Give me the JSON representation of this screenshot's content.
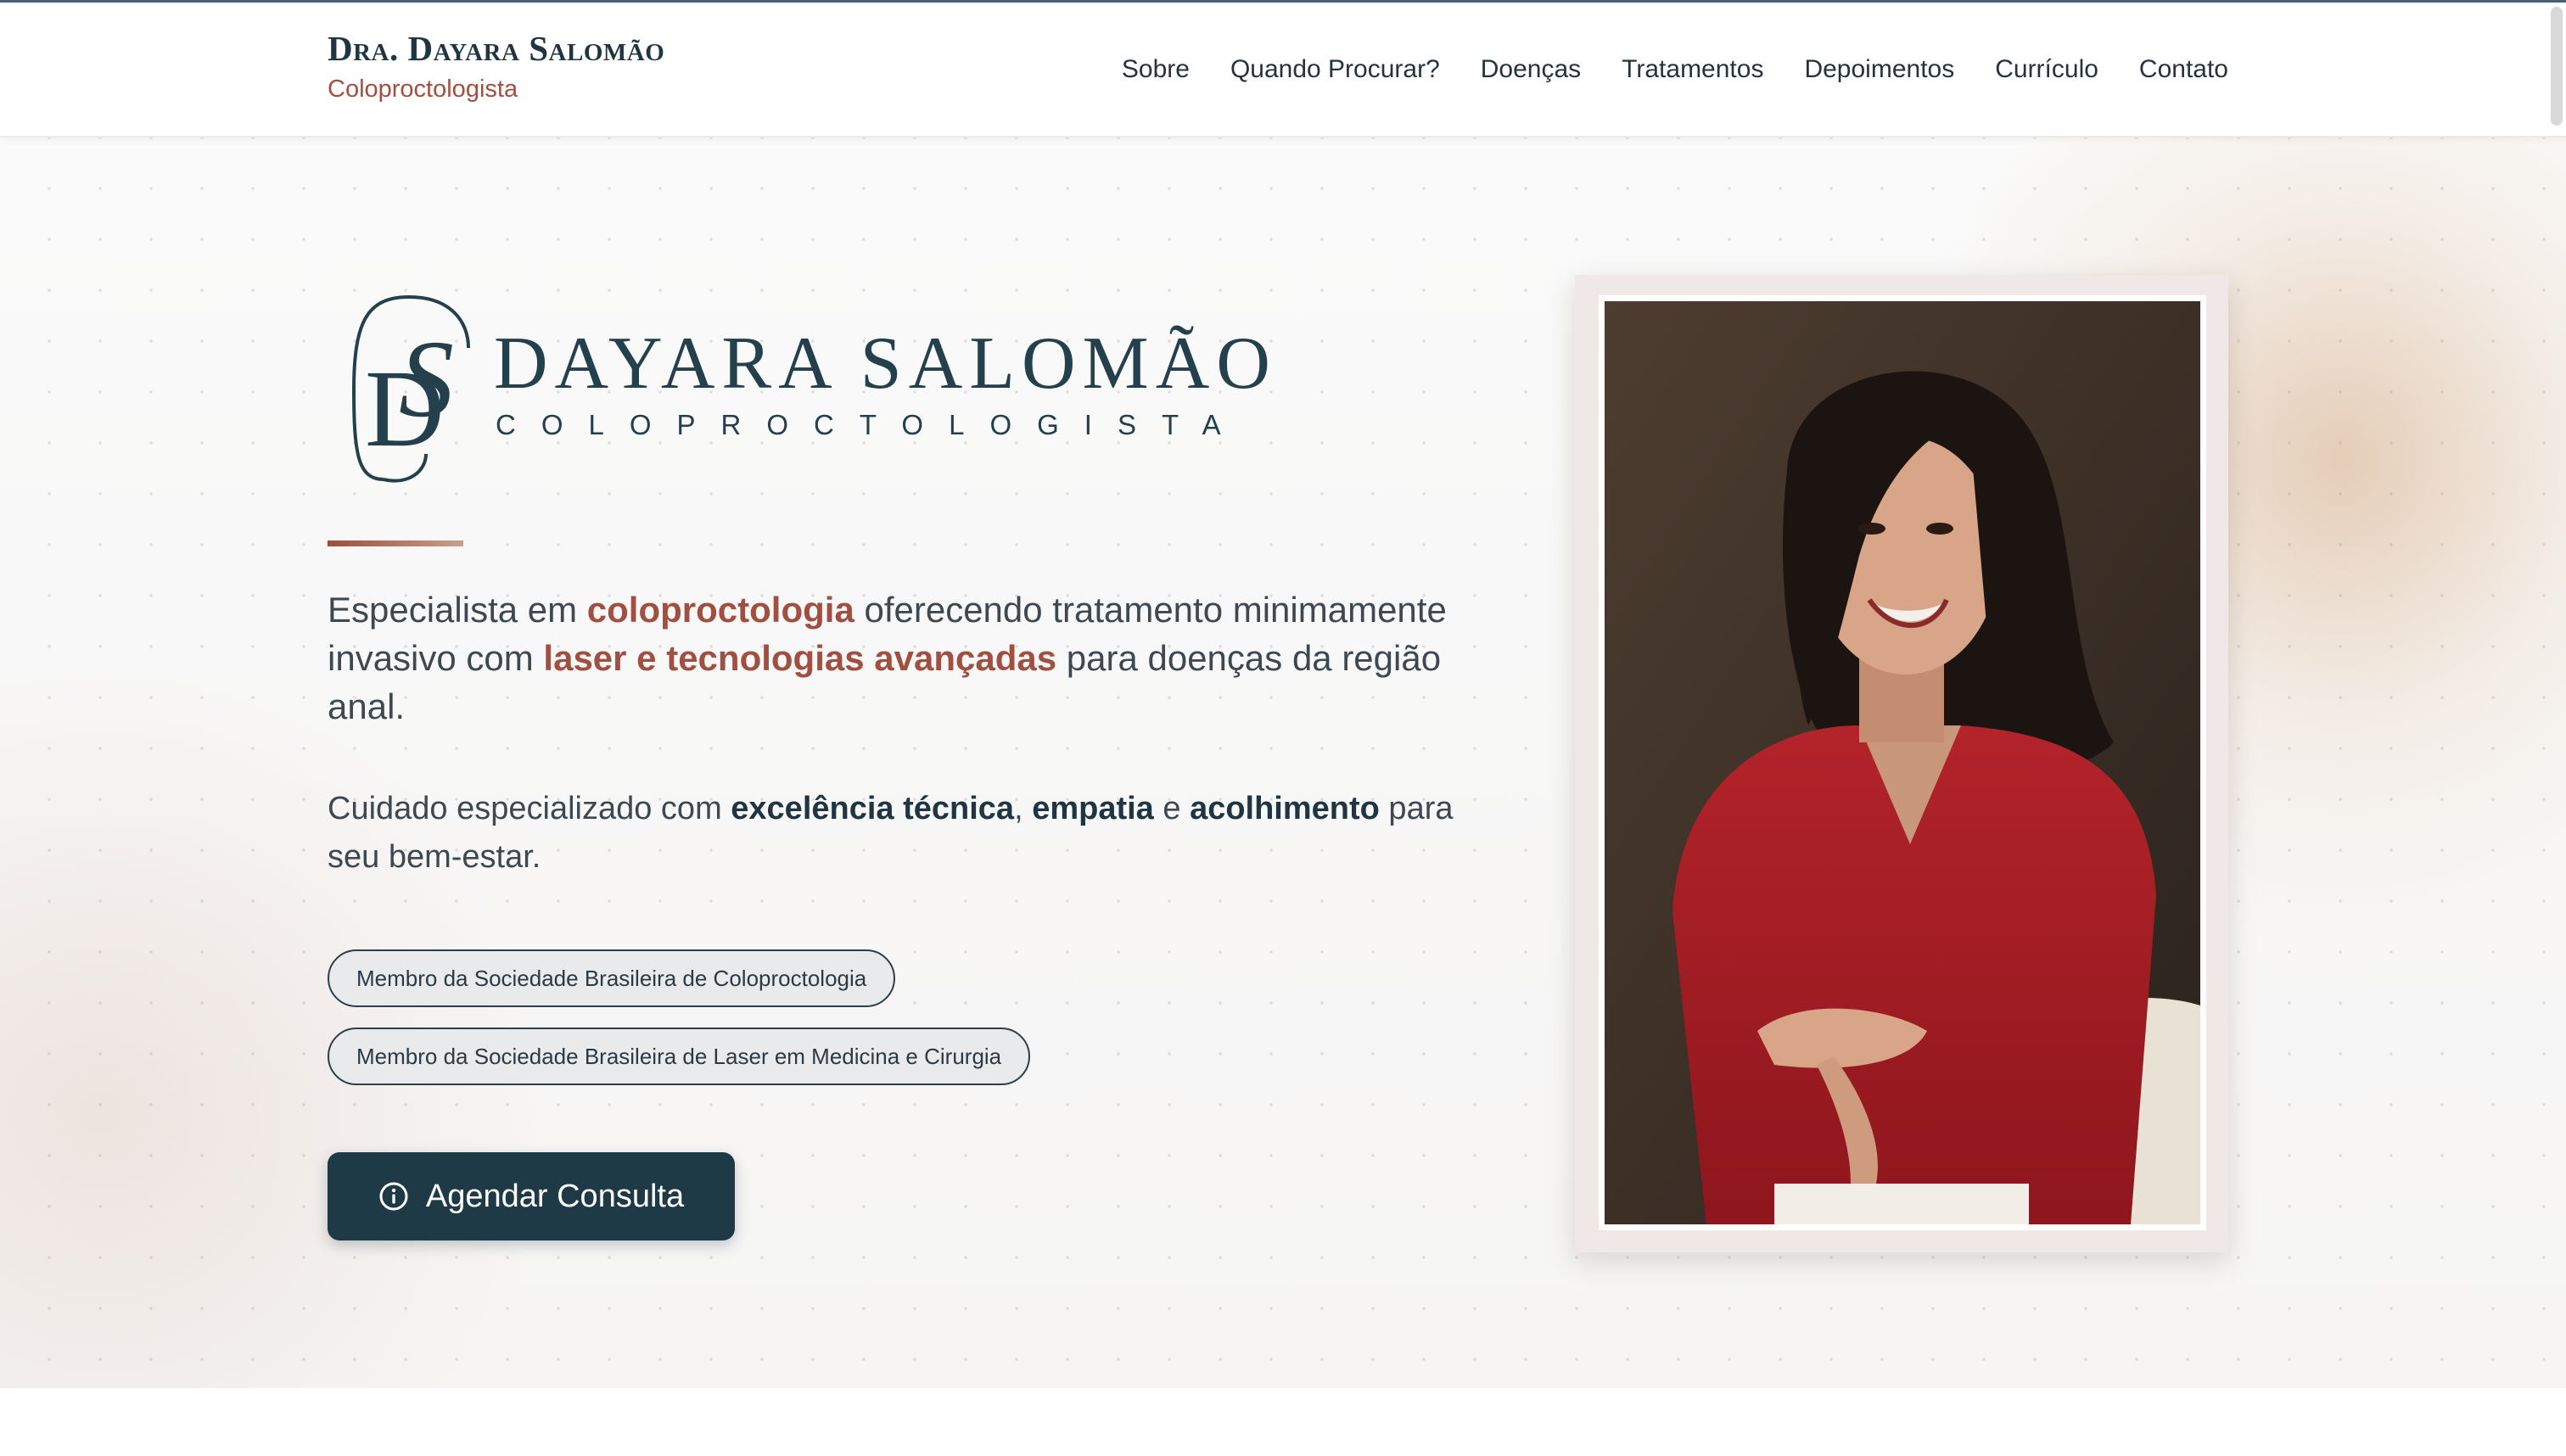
{
  "header": {
    "brand_name": "Dra. Dayara Salomão",
    "brand_subtitle": "Coloproctologista",
    "nav": [
      {
        "label": "Sobre"
      },
      {
        "label": "Quando Procurar?"
      },
      {
        "label": "Doenças"
      },
      {
        "label": "Tratamentos"
      },
      {
        "label": "Depoimentos"
      },
      {
        "label": "Currículo"
      },
      {
        "label": "Contato"
      }
    ]
  },
  "hero": {
    "logo": {
      "monogram": "DS",
      "name": "DAYARA SALOMÃO",
      "subtitle": "COLOPROCTOLOGISTA"
    },
    "lead": {
      "p1": "Especialista em ",
      "h1": "coloproctologia",
      "p2": " oferecendo tratamento minimamente invasivo com ",
      "h2": "laser e tecnologias avançadas",
      "p3": " para doenças da região anal."
    },
    "lead2": {
      "p1": "Cuidado especializado com ",
      "h1": "excelência técnica",
      "p2": ", ",
      "h2": "empatia",
      "p3": " e ",
      "h3": "acolhimento",
      "p4": " para seu bem-estar."
    },
    "badges": [
      {
        "label": "Membro da Sociedade Brasileira de Coloproctologia"
      },
      {
        "label": "Membro da Sociedade Brasileira de Laser em Medicina e Cirurgia"
      }
    ],
    "cta": {
      "label": "Agendar Consulta",
      "icon": "info-icon"
    },
    "photo": {
      "icon": "portrait-photo"
    }
  },
  "colors": {
    "navy": "#1f3a47",
    "accent": "#a04f40",
    "text": "#3d4850"
  }
}
